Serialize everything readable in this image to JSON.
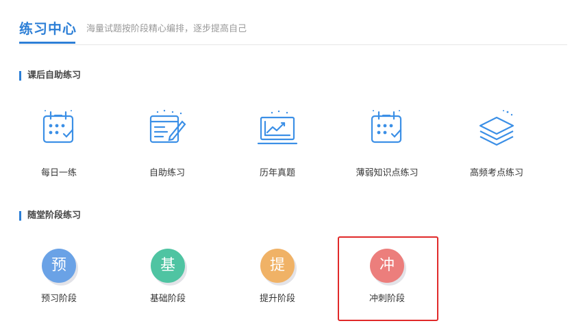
{
  "header": {
    "title": "练习中心",
    "subtitle": "海量试题按阶段精心编排，逐步提高自己"
  },
  "section1": {
    "title": "课后自助练习",
    "items": [
      {
        "label": "每日一练",
        "icon": "calendar-check-icon"
      },
      {
        "label": "自助练习",
        "icon": "notepad-pen-icon"
      },
      {
        "label": "历年真题",
        "icon": "chart-monitor-icon"
      },
      {
        "label": "薄弱知识点练习",
        "icon": "calendar-check-icon"
      },
      {
        "label": "高频考点练习",
        "icon": "layers-icon"
      }
    ]
  },
  "section2": {
    "title": "随堂阶段练习",
    "items": [
      {
        "label": "预习阶段",
        "char": "预",
        "color": "#6aa2e6"
      },
      {
        "label": "基础阶段",
        "char": "基",
        "color": "#4fc4a2"
      },
      {
        "label": "提升阶段",
        "char": "提",
        "color": "#f0b266"
      },
      {
        "label": "冲刺阶段",
        "char": "冲",
        "color": "#ec7e7c"
      }
    ]
  },
  "colors": {
    "accent": "#2d7fd6",
    "icon": "#3b8fe6",
    "highlight": "#e02828"
  }
}
